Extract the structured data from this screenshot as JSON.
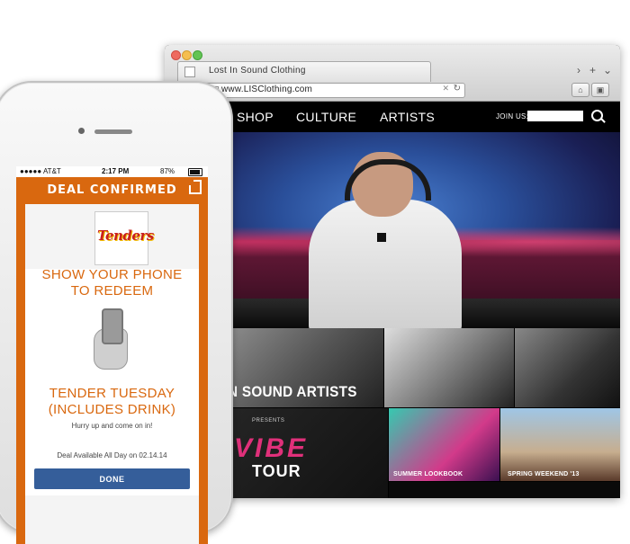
{
  "browser": {
    "tab_title": "Lost In Sound Clothing",
    "tab_controls": [
      "›",
      "+",
      "⌄"
    ],
    "url": "www.LISClothing.com"
  },
  "site": {
    "nav": [
      "SHOP",
      "CULTURE",
      "ARTISTS"
    ],
    "join_label": "JOIN US:"
  },
  "tiles": {
    "artists": "N SOUND ARTISTS",
    "presents": "PRESENTS",
    "vibe": "VIBE",
    "tour": "TOUR",
    "lookbook": "SUMMER LOOKBOOK",
    "spring": "SPRING WEEKEND '13"
  },
  "phone": {
    "carrier": "●●●●● AT&T",
    "time": "2:17 PM",
    "battery": "87%",
    "header": "DEAL CONFIRMED",
    "merchant": "Tenders",
    "redeem_line1": "SHOW YOUR PHONE",
    "redeem_line2": "TO REDEEM",
    "deal_line1": "TENDER TUESDAY",
    "deal_line2": "(INCLUDES DRINK)",
    "hurry": "Hurry up and come on in!",
    "availability": "Deal Available All Day on 02.14.14",
    "done": "DONE"
  }
}
